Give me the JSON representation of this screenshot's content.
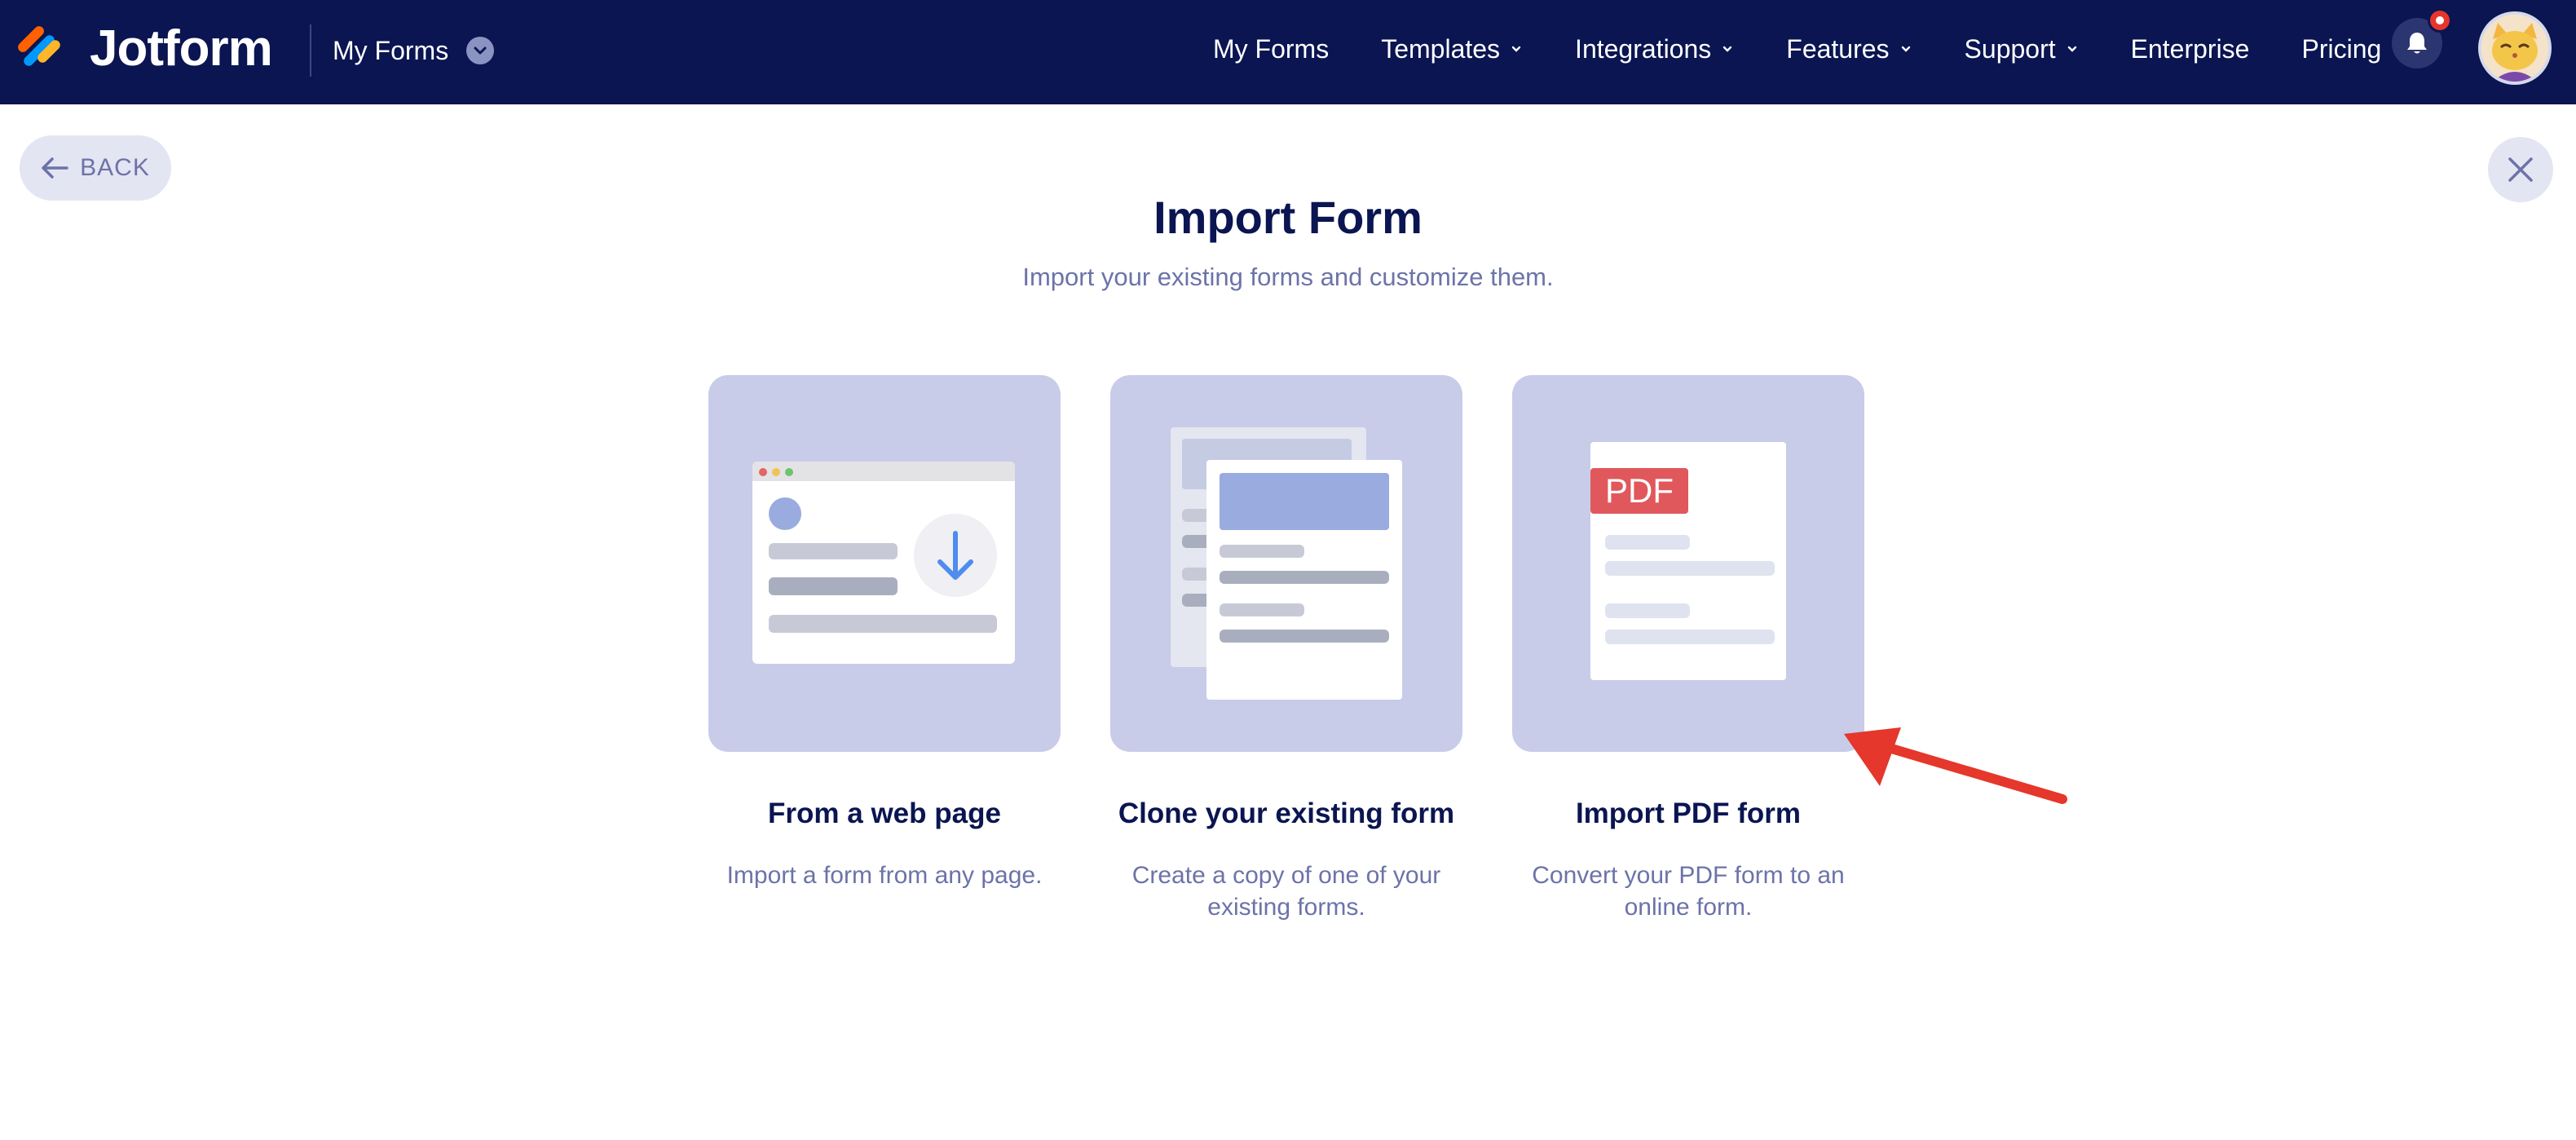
{
  "header": {
    "brand": "Jotform",
    "switcher_label": "My Forms",
    "nav": [
      {
        "label": "My Forms",
        "dropdown": false
      },
      {
        "label": "Templates",
        "dropdown": true
      },
      {
        "label": "Integrations",
        "dropdown": true
      },
      {
        "label": "Features",
        "dropdown": true
      },
      {
        "label": "Support",
        "dropdown": true
      },
      {
        "label": "Enterprise",
        "dropdown": false
      },
      {
        "label": "Pricing",
        "dropdown": false
      }
    ],
    "notification_icon": "bell-icon",
    "has_notification": true
  },
  "page": {
    "back_label": "BACK",
    "title": "Import Form",
    "subtitle": "Import your existing forms and customize them."
  },
  "options": [
    {
      "title": "From a web page",
      "description": "Import a form from any page."
    },
    {
      "title": "Clone your existing form",
      "description": "Create a copy of one of your existing forms."
    },
    {
      "title": "Import PDF form",
      "description": "Convert your PDF form to an online form.",
      "badge": "PDF"
    }
  ],
  "colors": {
    "nav_bg": "#0a1551",
    "card_bg": "#c8cce9",
    "accent_blue": "#9aabdf",
    "pdf_red": "#e0585b",
    "annotation_arrow": "#e5372b"
  }
}
